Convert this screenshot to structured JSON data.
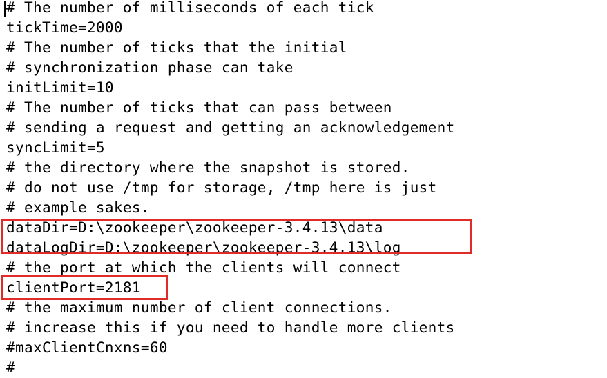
{
  "document": {
    "kind": "zookeeper-config-file",
    "background_color": "#ffffff",
    "text_color": "#000000",
    "lines": [
      {
        "text": "# The number of milliseconds of each tick"
      },
      {
        "text": "tickTime=2000"
      },
      {
        "text": "# The number of ticks that the initial"
      },
      {
        "text": "# synchronization phase can take"
      },
      {
        "text": "initLimit=10"
      },
      {
        "text": "# The number of ticks that can pass between"
      },
      {
        "text": "# sending a request and getting an acknowledgement"
      },
      {
        "text": "syncLimit=5"
      },
      {
        "text": "# the directory where the snapshot is stored."
      },
      {
        "text": "# do not use /tmp for storage, /tmp here is just"
      },
      {
        "text": "# example sakes."
      },
      {
        "text": "dataDir=D:\\zookeeper\\zookeeper-3.4.13\\data"
      },
      {
        "text": "dataLogDir=D:\\zookeeper\\zookeeper-3.4.13\\log"
      },
      {
        "text": "# the port at which the clients will connect"
      },
      {
        "text": "clientPort=2181"
      },
      {
        "text": "# the maximum number of client connections."
      },
      {
        "text": "# increase this if you need to handle more clients"
      },
      {
        "text": "#maxClientCnxns=60"
      },
      {
        "text": "#"
      }
    ]
  },
  "annotations": {
    "color": "#e02b28",
    "boxes": [
      {
        "id": "data-directory-highlight",
        "covers": "dataDir=D:\\zookeeper\\zookeeper-3.4.13\\data and dataLogDir=D:\\zookeeper\\zookeeper-3.4.13\\log"
      },
      {
        "id": "client-port-highlight",
        "covers": "clientPort=2181"
      }
    ]
  },
  "caret": {
    "present": true,
    "location": "start-of-document"
  }
}
